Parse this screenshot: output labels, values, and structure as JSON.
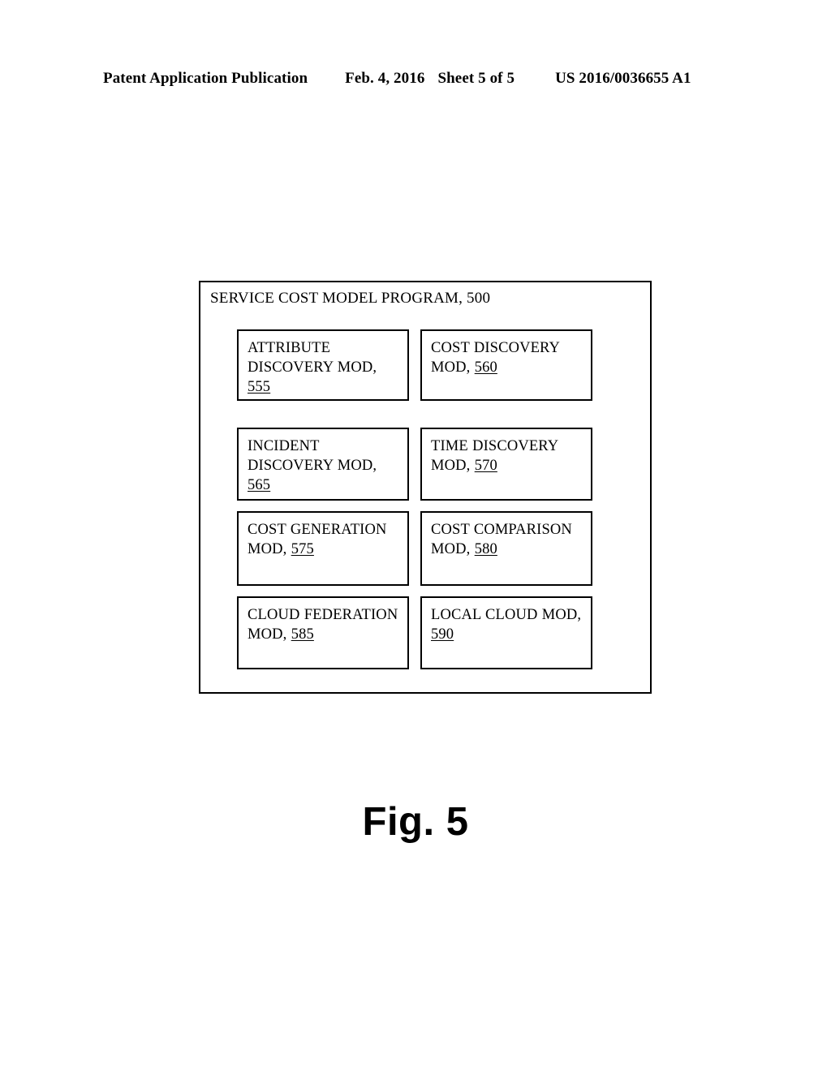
{
  "header": {
    "publication": "Patent Application Publication",
    "date": "Feb. 4, 2016",
    "sheet": "Sheet 5 of 5",
    "document_number": "US 2016/0036655 A1"
  },
  "figure": {
    "caption": "Fig. 5",
    "program_title": "SERVICE COST MODEL PROGRAM, 500",
    "program_label_text": "SERVICE COST MODEL PROGRAM,",
    "program_ref": "500",
    "modules": [
      {
        "name": "ATTRIBUTE DISCOVERY MOD,",
        "ref": "555"
      },
      {
        "name": "COST DISCOVERY MOD,",
        "ref": "560"
      },
      {
        "name": "INCIDENT DISCOVERY MOD,",
        "ref": "565"
      },
      {
        "name": "TIME DISCOVERY MOD,",
        "ref": "570"
      },
      {
        "name": "COST GENERATION MOD,",
        "ref": "575"
      },
      {
        "name": "COST COMPARISON MOD,",
        "ref": "580"
      },
      {
        "name": "CLOUD FEDERATION MOD,",
        "ref": "585"
      },
      {
        "name": "LOCAL CLOUD MOD,",
        "ref": "590"
      }
    ]
  },
  "colors": {
    "line": "#000000",
    "background": "#ffffff",
    "text": "#000000"
  }
}
